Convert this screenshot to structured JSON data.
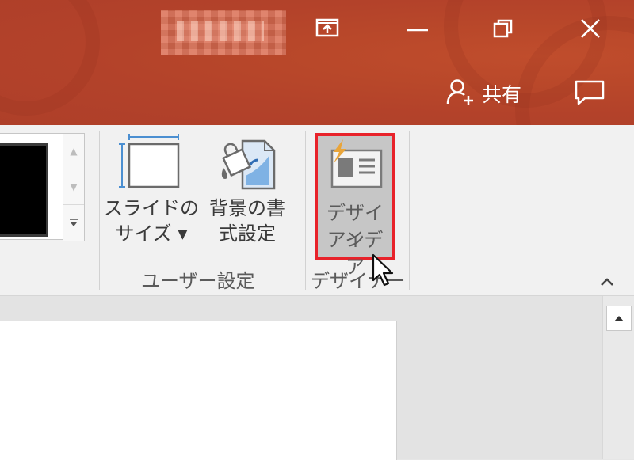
{
  "titlebar": {
    "share_label": "共有"
  },
  "ribbon": {
    "slide_size": {
      "line1": "スライドの",
      "line2": "サイズ ▾"
    },
    "format_background": {
      "line1": "背景の書",
      "line2": "式設定"
    },
    "design_ideas": {
      "line1": "デザイン",
      "line2": "アイデア"
    },
    "groups": {
      "customize": "ユーザー設定",
      "designer": "デザイナー"
    }
  },
  "colors": {
    "titlebar": "#b3422a",
    "highlight_border": "#e8222a",
    "ribbon_bg": "#f1f1f1"
  },
  "icons": {
    "present": "present-icon",
    "minimize": "minimize-icon",
    "restore": "restore-icon",
    "close": "close-icon",
    "share": "add-person-icon",
    "comments": "comment-icon",
    "slide_size": "slide-size-icon",
    "format_background": "paint-bucket-icon",
    "design_ideas": "design-ideas-icon",
    "collapse": "chevron-up-icon"
  }
}
